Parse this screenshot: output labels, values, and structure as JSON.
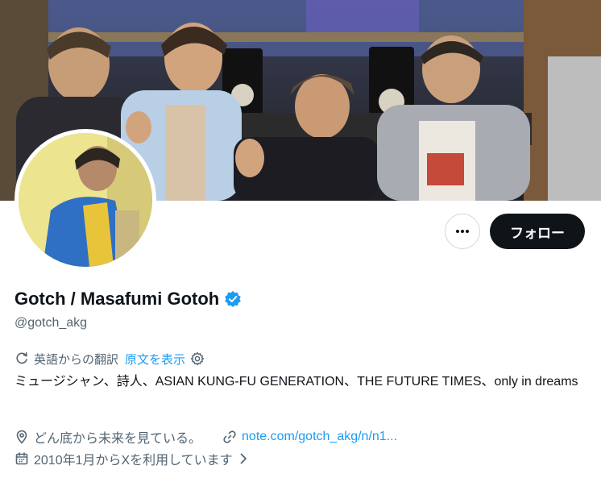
{
  "profile": {
    "display_name": "Gotch / Masafumi Gotoh",
    "handle": "@gotch_akg",
    "verified": true,
    "follow_label": "フォロー",
    "more_icon": "more-horizontal-icon"
  },
  "translation": {
    "label": "英語からの翻訳",
    "show_original": "原文を表示"
  },
  "bio": "ミュージシャン、詩人、ASIAN KUNG-FU GENERATION、THE FUTURE TIMES、only in dreams",
  "meta": {
    "location": "どん底から未来を見ている。",
    "link": "note.com/gotch_akg/n/n1...",
    "joined": "2010年1月からXを利用しています"
  },
  "colors": {
    "accent": "#1d9bf0",
    "text_primary": "#0f1419",
    "text_secondary": "#536471",
    "follow_bg": "#0f1419"
  }
}
